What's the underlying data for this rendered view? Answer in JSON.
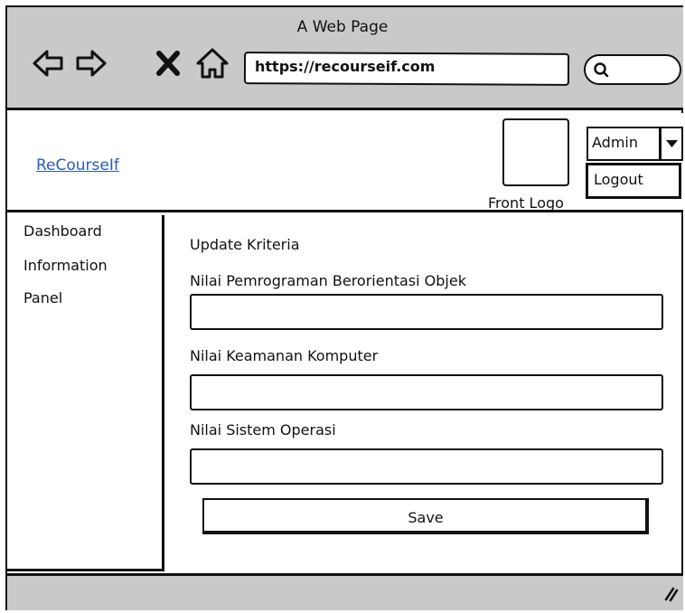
{
  "browser": {
    "window_title": "A Web Page",
    "url": "https://recourseif.com",
    "nav_icons": [
      "back-arrow-icon",
      "forward-arrow-icon",
      "stop-icon",
      "home-icon",
      "search-icon"
    ]
  },
  "header": {
    "brand": "ReCourseIf",
    "logo_label": "Front Logo",
    "user_menu": {
      "selected": "Admin",
      "items": [
        "Logout"
      ]
    }
  },
  "sidebar": {
    "items": [
      "Dashboard",
      "Information",
      "Panel"
    ]
  },
  "form": {
    "title": "Update Kriteria",
    "fields": [
      {
        "label": "Nilai Pemrograman Berorientasi Objek",
        "value": ""
      },
      {
        "label": "Nilai Keamanan Komputer",
        "value": ""
      },
      {
        "label": "Nilai Sistem Operasi",
        "value": ""
      }
    ],
    "save_label": "Save"
  }
}
